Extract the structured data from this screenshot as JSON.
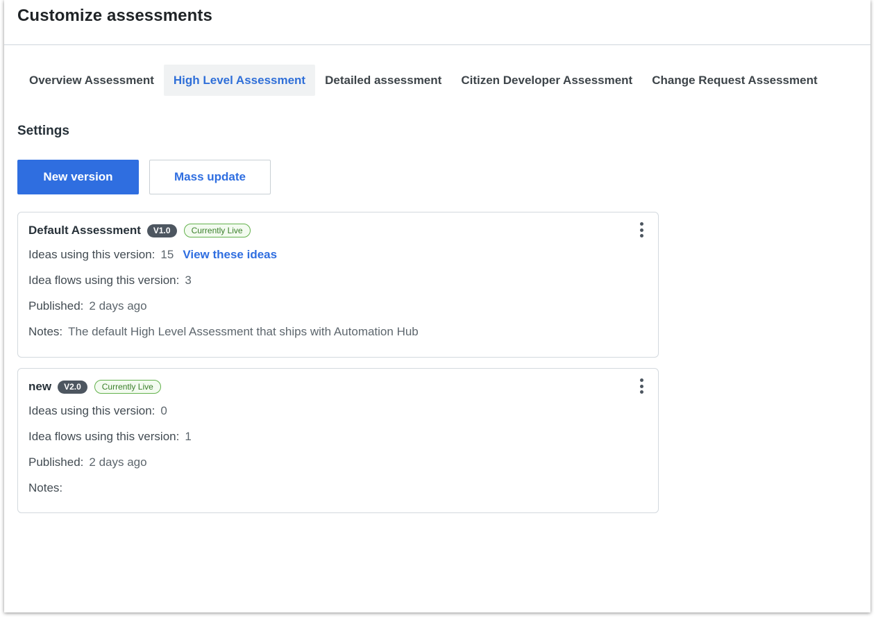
{
  "page": {
    "title": "Customize assessments"
  },
  "tabs": [
    {
      "label": "Overview Assessment",
      "active": false
    },
    {
      "label": "High Level Assessment",
      "active": true
    },
    {
      "label": "Detailed assessment",
      "active": false
    },
    {
      "label": "Citizen Developer Assessment",
      "active": false
    },
    {
      "label": "Change Request Assessment",
      "active": false
    }
  ],
  "settings": {
    "heading": "Settings",
    "new_version_label": "New version",
    "mass_update_label": "Mass update"
  },
  "labels": {
    "ideas_using": "Ideas using this version:",
    "flows_using": "Idea flows using this version:",
    "published": "Published:",
    "notes": "Notes:"
  },
  "versions": [
    {
      "name": "Default Assessment",
      "version": "V1.0",
      "status": "Currently Live",
      "ideas_count": "15",
      "view_link": "View these ideas",
      "flows_count": "3",
      "published": "2 days ago",
      "notes": "The default High Level Assessment that ships with Automation Hub"
    },
    {
      "name": "new",
      "version": "V2.0",
      "status": "Currently Live",
      "ideas_count": "0",
      "view_link": "",
      "flows_count": "1",
      "published": "2 days ago",
      "notes": ""
    }
  ],
  "colors": {
    "primary": "#2f6ee0",
    "live_border": "#62b14b",
    "version_badge_bg": "#4d5660"
  }
}
